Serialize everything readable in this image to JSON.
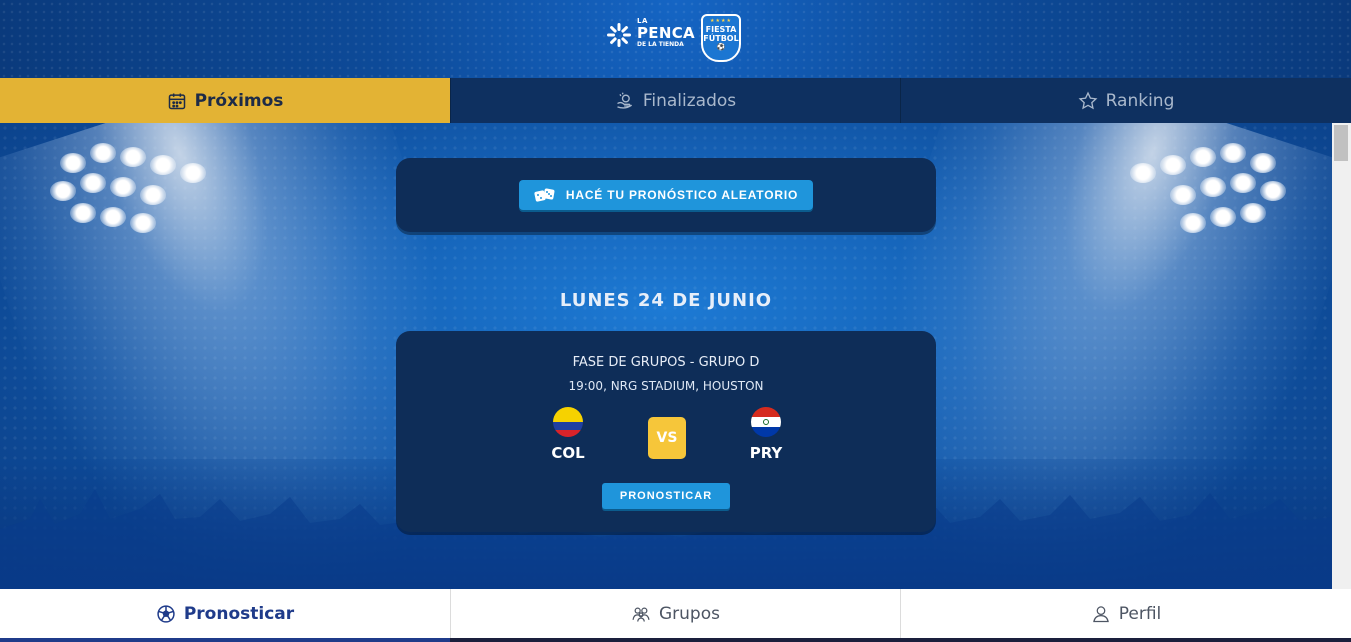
{
  "brand": {
    "logo_small_top": "LA",
    "logo_main": "PENCA",
    "logo_small_bottom": "DE LA TIENDA",
    "badge_line1": "FIESTA",
    "badge_line2": "FÚTBOL"
  },
  "tabs": [
    {
      "label": "Próximos",
      "icon": "calendar-icon",
      "active": true
    },
    {
      "label": "Finalizados",
      "icon": "trophy-hand-icon",
      "active": false
    },
    {
      "label": "Ranking",
      "icon": "star-icon",
      "active": false
    }
  ],
  "random_card": {
    "button_label": "HACÉ TU PRONÓSTICO ALEATORIO",
    "icon": "dice-icon"
  },
  "date_title": "LUNES 24 DE JUNIO",
  "match": {
    "phase": "FASE DE GRUPOS - GRUPO D",
    "venue": "19:00, NRG STADIUM, HOUSTON",
    "home": {
      "code": "COL",
      "flag_colors": [
        "#f6d200",
        "#1f3fa0",
        "#d8232a"
      ]
    },
    "away": {
      "code": "PRY",
      "flag_colors": [
        "#d52b1e",
        "#ffffff",
        "#0038a8"
      ]
    },
    "vs_label": "VS",
    "button_label": "PRONOSTICAR"
  },
  "bottom_nav": [
    {
      "label": "Pronosticar",
      "icon": "soccer-ball-icon",
      "active": true
    },
    {
      "label": "Grupos",
      "icon": "users-icon",
      "active": false
    },
    {
      "label": "Perfil",
      "icon": "user-icon",
      "active": false
    }
  ],
  "colors": {
    "accent_yellow": "#e3b334",
    "navy": "#0e2d58",
    "button_blue": "#1f95db",
    "active_nav": "#1f3b8a"
  }
}
